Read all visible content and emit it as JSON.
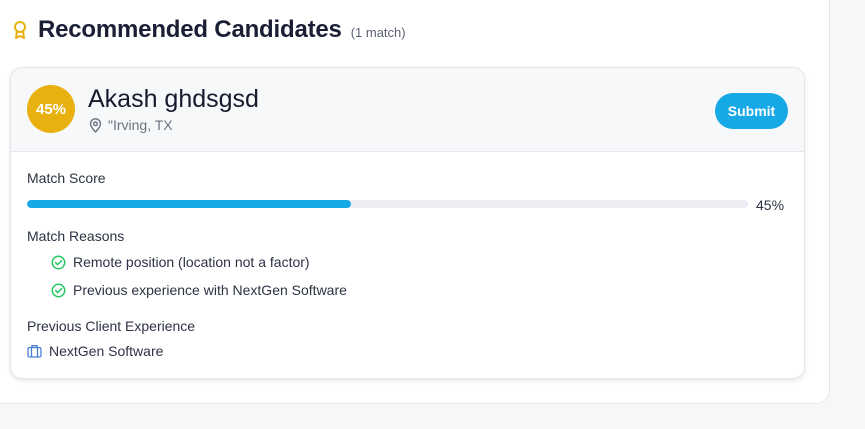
{
  "header": {
    "title": "Recommended Candidates",
    "match_count": "(1 match)"
  },
  "candidate": {
    "score_badge": "45%",
    "name": "Akash ghdsgsd",
    "location": "\"Irving, TX",
    "submit_label": "Submit",
    "match_score_label": "Match Score",
    "match_score_value": 45,
    "match_score_text": "45%",
    "reasons_label": "Match Reasons",
    "reasons": [
      "Remote position (location not a factor)",
      "Previous experience with NextGen Software"
    ],
    "client_label": "Previous Client Experience",
    "client": "NextGen Software"
  },
  "colors": {
    "accent": "#17a9e6",
    "score_badge": "#e8b10f",
    "check": "#22c55e",
    "award": "#e8b10f"
  },
  "icons": {
    "header": "award-icon",
    "location": "map-pin-icon",
    "reason": "check-circle-icon",
    "client": "briefcase-icon"
  }
}
